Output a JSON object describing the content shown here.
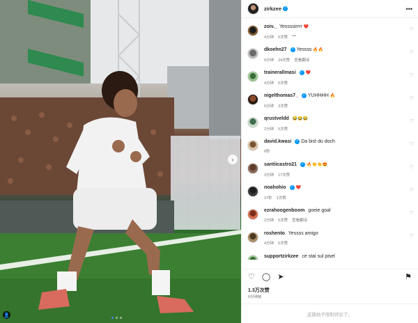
{
  "post": {
    "author": "zirkzee",
    "more_icon": "more-horizontal-icon"
  },
  "comments": [
    {
      "user": "zoiv._",
      "text": "Yessssirrrr",
      "emojis": "❤️",
      "time": "4分钟",
      "likes": "6次赞",
      "extra": "•••"
    },
    {
      "user": "dkoehn27",
      "text": "Yessss",
      "emojis": "🔥🔥",
      "time": "5分钟",
      "likes": "24次赞",
      "extra": "查看翻译"
    },
    {
      "user": "trainerallmasi",
      "text": "",
      "emojis": "❤️",
      "time": "4分钟",
      "likes": "6次赞",
      "extra": ""
    },
    {
      "user": "nigelthomas7_",
      "text": "YUHHHH",
      "emojis": "🔥",
      "time": "5分钟",
      "likes": "3次赞",
      "extra": ""
    },
    {
      "user": "qrustveldd",
      "text": "",
      "emojis": "😂😂😂",
      "time": "2分钟",
      "likes": "5次赞",
      "extra": ""
    },
    {
      "user": "david.kwasi",
      "text": "Da bist du doch",
      "emojis": "",
      "time": "6秒",
      "likes": "",
      "extra": ""
    },
    {
      "user": "santiicastro21",
      "text": "",
      "emojis": "🔥👏👏😍",
      "time": "3分钟",
      "likes": "17次赞",
      "extra": ""
    },
    {
      "user": "noahohio",
      "text": "",
      "emojis": "❤️",
      "time": "27秒",
      "likes": "1次赞",
      "extra": ""
    },
    {
      "user": "ezrahoogenboom",
      "text": "goeie goal",
      "emojis": "",
      "time": "2分钟",
      "likes": "5次赞",
      "extra": "查看翻译"
    },
    {
      "user": "roshento",
      "text": "Yessss amigo",
      "emojis": "",
      "time": "4分钟",
      "likes": "5次赞",
      "extra": ""
    },
    {
      "user": "supportzirkzee",
      "text": "ce stai sul pisel",
      "emojis": "",
      "time": "",
      "likes": "",
      "extra": ""
    }
  ],
  "actions": {
    "like_icon": "heart-icon",
    "comment_icon": "comment-icon",
    "share_icon": "send-icon",
    "save_icon": "bookmark-icon"
  },
  "likes": "1.3万次赞",
  "date": "6分钟前",
  "comments_closed": "这篇帖子限制评论了。",
  "colors": {
    "verified": "#0095f6",
    "pitch": "#3c7f33",
    "kit": "#f2f2f2"
  }
}
